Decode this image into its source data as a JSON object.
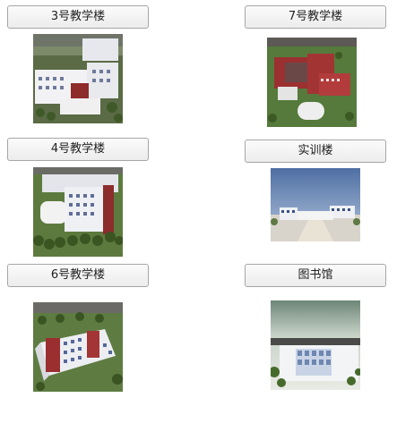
{
  "buildings": [
    {
      "label": "3号教学楼",
      "thumbnail": "building-3-aerial"
    },
    {
      "label": "7号教学楼",
      "thumbnail": "building-7-aerial"
    },
    {
      "label": "4号教学楼",
      "thumbnail": "building-4-aerial"
    },
    {
      "label": "实训楼",
      "thumbnail": "training-building-aerial"
    },
    {
      "label": "6号教学楼",
      "thumbnail": "building-6-aerial"
    },
    {
      "label": "图书馆",
      "thumbnail": "library-aerial"
    }
  ]
}
